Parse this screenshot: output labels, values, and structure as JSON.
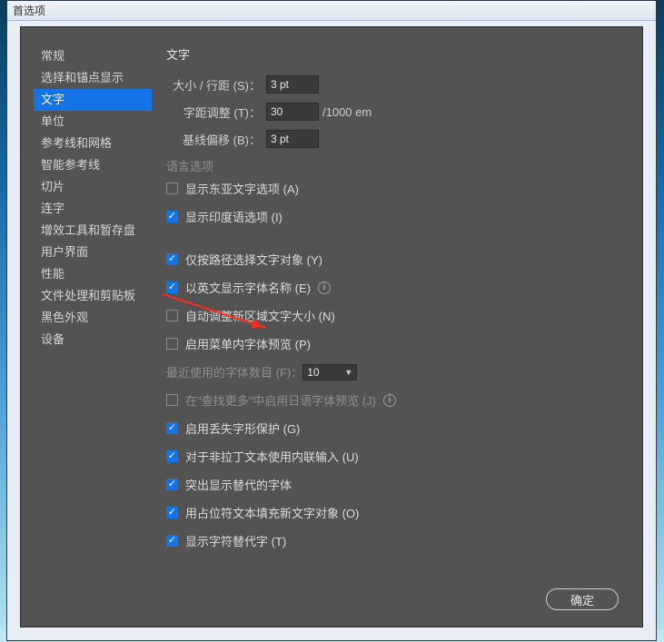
{
  "window": {
    "title": "首选项"
  },
  "sidebar": {
    "items": [
      {
        "label": "常规"
      },
      {
        "label": "选择和锚点显示"
      },
      {
        "label": "文字",
        "selected": true
      },
      {
        "label": "单位"
      },
      {
        "label": "参考线和网格"
      },
      {
        "label": "智能参考线"
      },
      {
        "label": "切片"
      },
      {
        "label": "连字"
      },
      {
        "label": "增效工具和暂存盘"
      },
      {
        "label": "用户界面"
      },
      {
        "label": "性能"
      },
      {
        "label": "文件处理和剪贴板"
      },
      {
        "label": "黑色外观"
      },
      {
        "label": "设备"
      }
    ]
  },
  "content": {
    "title": "文字",
    "size_label": "大小 / 行距 (S)：",
    "size_value": "3 pt",
    "tracking_label": "字距调整 (T)：",
    "tracking_value": "30",
    "tracking_unit": "/1000 em",
    "baseline_label": "基线偏移 (B)：",
    "baseline_value": "3 pt",
    "lang_section": "语言选项",
    "chk_east_asian": {
      "label": "显示东亚文字选项 (A)",
      "checked": false
    },
    "chk_indic": {
      "label": "显示印度语选项 (I)",
      "checked": true
    },
    "chk_path": {
      "label": "仅按路径选择文字对象 (Y)",
      "checked": true
    },
    "chk_english_font": {
      "label": "以英文显示字体名称 (E)",
      "checked": true,
      "info": true
    },
    "chk_auto_resize": {
      "label": "自动调整新区域文字大小 (N)",
      "checked": false
    },
    "chk_menu_preview": {
      "label": "启用菜单内字体预览 (P)",
      "checked": false
    },
    "recent_fonts_label": "最近使用的字体数目 (F)：",
    "recent_fonts_value": "10",
    "chk_jp_preview": {
      "label": "在\"查找更多\"中启用日语字体预览 (J)",
      "checked": false,
      "info": true
    },
    "chk_glyph_protect": {
      "label": "启用丢失字形保护 (G)",
      "checked": true
    },
    "chk_inline_input": {
      "label": "对于非拉丁文本使用内联输入 (U)",
      "checked": true
    },
    "chk_highlight_sub": {
      "label": "突出显示替代的字体",
      "checked": true
    },
    "chk_placeholder": {
      "label": "用占位符文本填充新文字对象 (O)",
      "checked": true
    },
    "chk_show_alt": {
      "label": "显示字符替代字 (T)",
      "checked": true
    }
  },
  "buttons": {
    "ok": "确定"
  }
}
